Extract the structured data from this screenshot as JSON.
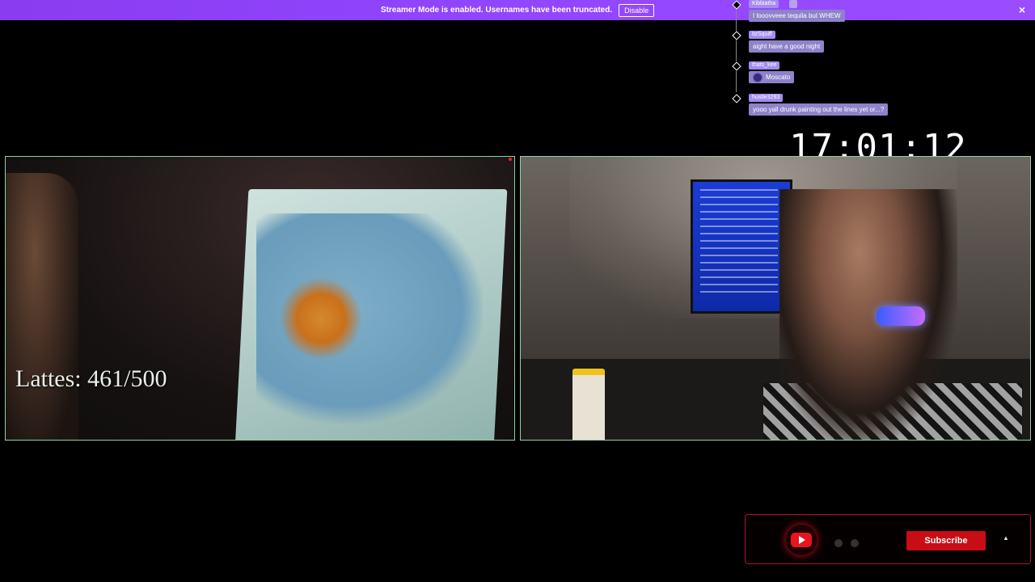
{
  "banner": {
    "message": "Streamer Mode is enabled. Usernames have been truncated.",
    "disable_label": "Disable",
    "close_icon": "×",
    "color": "#9146ff"
  },
  "chat": {
    "messages": [
      {
        "user": "Kibbiatha",
        "text": "I looovveee tequila but WHEW",
        "has_badge": true
      },
      {
        "user": "itzSquiff",
        "text": "aight have a good night"
      },
      {
        "user": "thats_kee",
        "text": "Moscato",
        "has_emote": true
      },
      {
        "user": "hustle3293",
        "text": "yooo yall drunk painting out the lines yet or...?"
      }
    ]
  },
  "timer": {
    "value": "17:01:12"
  },
  "overlay": {
    "lattes": "Lattes: 461/500"
  },
  "subscribe": {
    "label": "Subscribe",
    "icon": "youtube-icon",
    "caret": "▲",
    "accent": "#c80d14"
  }
}
